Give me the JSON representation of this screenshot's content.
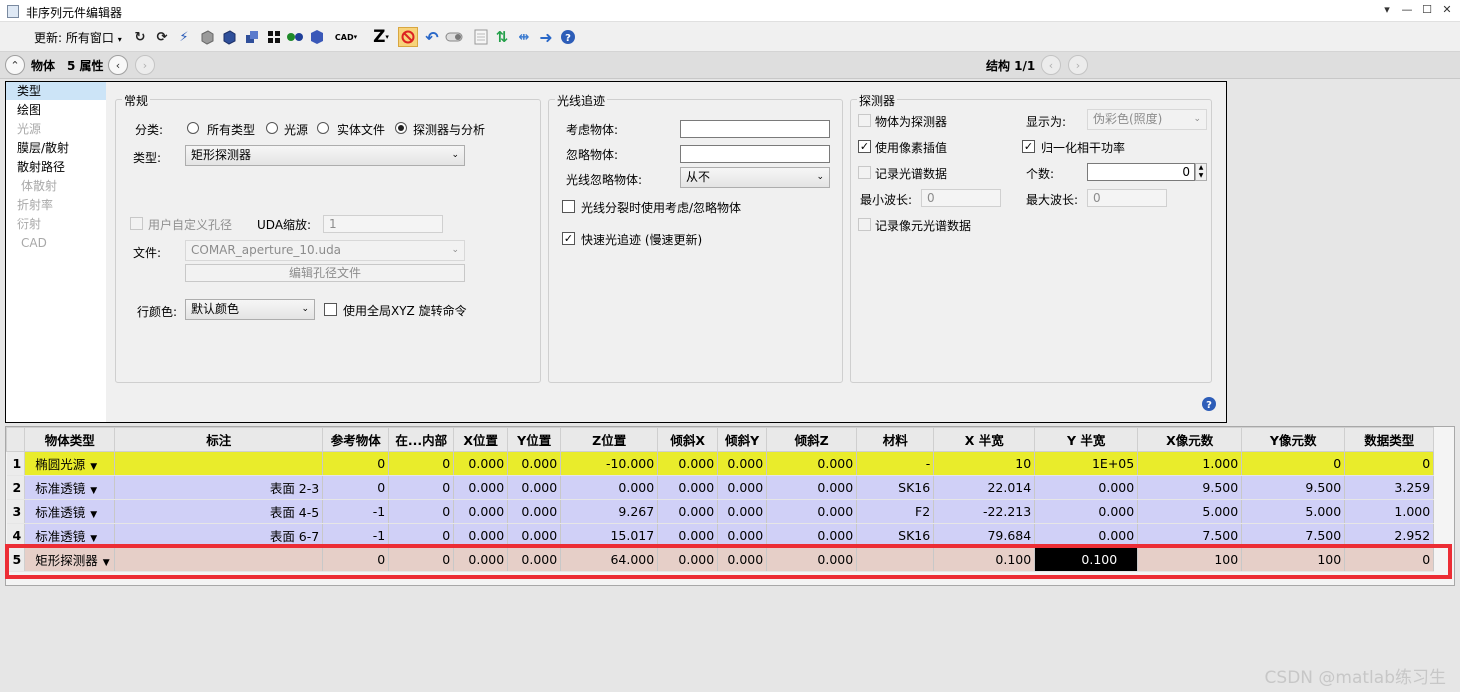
{
  "window": {
    "title": "非序列元件编辑器",
    "buttons": [
      "▾",
      "—",
      "☐",
      "✕"
    ]
  },
  "toolbar": {
    "update_label": "更新: 所有窗口",
    "update_arrow": "▾",
    "cad_label": "CAD",
    "z_label": "Z"
  },
  "objbar": {
    "object_label": "物体",
    "property_label": "5 属性",
    "structure_label": "结构 1/1"
  },
  "categories": [
    {
      "label": "类型"
    },
    {
      "label": "绘图"
    },
    {
      "label": "光源"
    },
    {
      "label": "膜层/散射"
    },
    {
      "label": "散射路径"
    },
    {
      "label": "体散射"
    },
    {
      "label": "折射率"
    },
    {
      "label": "衍射"
    },
    {
      "label": "CAD"
    }
  ],
  "general": {
    "title": "常规",
    "class_label": "分类:",
    "class_options": [
      "所有类型",
      "光源",
      "实体文件",
      "探测器与分析"
    ],
    "type_label": "类型:",
    "type_value": "矩形探测器",
    "user_aperture_label": "用户自定义孔径",
    "uda_scale_label": "UDA缩放:",
    "uda_scale_value": "1",
    "file_label": "文件:",
    "file_value": "COMAR_aperture_10.uda",
    "edit_aperture_label": "编辑孔径文件",
    "row_color_label": "行颜色:",
    "row_color_value": "默认颜色",
    "global_xyz_label": "使用全局XYZ 旋转命令"
  },
  "raytrace": {
    "title": "光线追迹",
    "consider_label": "考虑物体:",
    "consider_value": "",
    "ignore_label": "忽略物体:",
    "ignore_value": "",
    "ray_ignore_label": "光线忽略物体:",
    "ray_ignore_value": "从不",
    "split_label": "光线分裂时使用考虑/忽略物体",
    "fast_label": "快速光追迹 (慢速更新)"
  },
  "detector": {
    "title": "探测器",
    "as_detector_label": "物体为探测器",
    "display_label": "显示为:",
    "display_value": "伪彩色(照度)",
    "pixel_interp_label": "使用像素插值",
    "normalize_label": "归一化相干功率",
    "record_spectrum_label": "记录光谱数据",
    "count_label": "个数:",
    "count_value": "0",
    "min_wl_label": "最小波长:",
    "min_wl_value": "0",
    "max_wl_label": "最大波长:",
    "max_wl_value": "0",
    "record_pixel_spectrum_label": "记录像元光谱数据"
  },
  "grid": {
    "headers": [
      "物体类型",
      "标注",
      "参考物体",
      "在...内部",
      "X位置",
      "Y位置",
      "Z位置",
      "倾斜X",
      "倾斜Y",
      "倾斜Z",
      "材料",
      "X 半宽",
      "Y 半宽",
      "X像元数",
      "Y像元数",
      "数据类型"
    ],
    "rows": [
      {
        "num": "1",
        "cells": [
          "椭圆光源",
          "",
          "0",
          "0",
          "0.000",
          "0.000",
          "-10.000",
          "0.000",
          "0.000",
          "0.000",
          "-",
          "10",
          "1E+05",
          "1.000",
          "0",
          "0"
        ]
      },
      {
        "num": "2",
        "cells": [
          "标准透镜",
          "表面 2-3",
          "0",
          "0",
          "0.000",
          "0.000",
          "0.000",
          "0.000",
          "0.000",
          "0.000",
          "SK16",
          "22.014",
          "0.000",
          "9.500",
          "9.500",
          "3.259"
        ]
      },
      {
        "num": "3",
        "cells": [
          "标准透镜",
          "表面 4-5",
          "-1",
          "0",
          "0.000",
          "0.000",
          "9.267",
          "0.000",
          "0.000",
          "0.000",
          "F2",
          "-22.213",
          "0.000",
          "5.000",
          "5.000",
          "1.000"
        ]
      },
      {
        "num": "4",
        "cells": [
          "标准透镜",
          "表面 6-7",
          "-1",
          "0",
          "0.000",
          "0.000",
          "15.017",
          "0.000",
          "0.000",
          "0.000",
          "SK16",
          "79.684",
          "0.000",
          "7.500",
          "7.500",
          "2.952"
        ]
      },
      {
        "num": "5",
        "cells": [
          "矩形探测器",
          "",
          "0",
          "0",
          "0.000",
          "0.000",
          "64.000",
          "0.000",
          "0.000",
          "0.000",
          "",
          "0.100",
          "0.100",
          "100",
          "100",
          "0"
        ]
      }
    ]
  },
  "watermark": "CSDN @matlab练习生",
  "colors": {
    "source_row": "#e9ec2b",
    "lens_row": "#d0d0f7",
    "detector_row": "#e6cfc8",
    "highlight": "#ec2d35",
    "selected_category": "#cce4f7"
  }
}
